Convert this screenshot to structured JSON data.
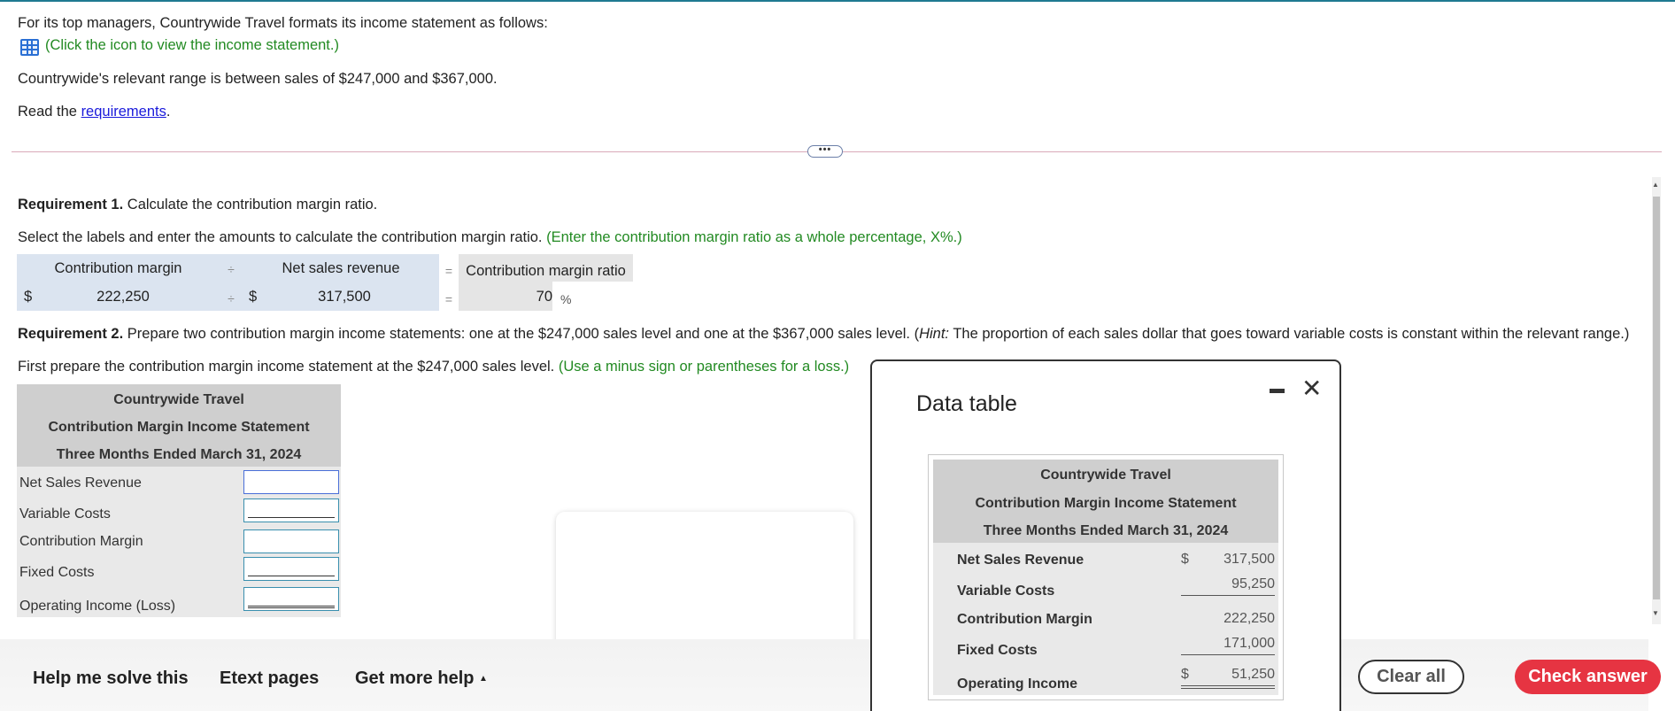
{
  "intro": {
    "line1": "For its top managers, Countrywide Travel formats its income statement as follows:",
    "icon_link": "(Click the icon to view the income statement.)",
    "range_text": "Countrywide's relevant range is between sales of $247,000 and $367,000.",
    "read_prefix": "Read the ",
    "read_link": "requirements",
    "read_suffix": ".",
    "more_button": "•••"
  },
  "req1": {
    "title_bold": "Requirement 1.",
    "title_rest": " Calculate the contribution margin ratio.",
    "instruction": "Select the labels and enter the amounts to calculate the contribution margin ratio.",
    "hint": "(Enter the contribution margin ratio as a whole percentage, X%.)",
    "header_numerator": "Contribution margin",
    "header_divide": "÷",
    "header_denominator": "Net sales revenue",
    "header_equals": "=",
    "header_result": "Contribution margin ratio",
    "dollar": "$",
    "numerator_value": "222,250",
    "divide": "÷",
    "dollar2": "$",
    "denominator_value": "317,500",
    "equals": "=",
    "result_value": "70",
    "percent": "%"
  },
  "req2": {
    "title_bold": "Requirement 2.",
    "title_rest_a": " Prepare two contribution margin income statements: one at the $247,000 sales level and one at the $367,000 sales level. (",
    "hint_italic": "Hint:",
    "title_rest_b": " The proportion of each sales dollar that goes toward variable costs is constant within the relevant range.)",
    "instruction": "First prepare the contribution margin income statement at the $247,000 sales level.",
    "hint": "(Use a minus sign or parentheses for a loss.)"
  },
  "statement": {
    "company": "Countrywide Travel",
    "title": "Contribution Margin Income Statement",
    "period": "Three Months Ended March 31, 2024",
    "rows": [
      "Net Sales Revenue",
      "Variable Costs",
      "Contribution Margin",
      "Fixed Costs",
      "Operating Income (Loss)"
    ]
  },
  "modal": {
    "title": "Data table",
    "company": "Countrywide Travel",
    "statement_title": "Contribution Margin Income Statement",
    "period": "Three Months Ended March 31, 2024",
    "rows": [
      {
        "label": "Net Sales Revenue",
        "dollar": "$",
        "value": "317,500"
      },
      {
        "label": "Variable Costs",
        "dollar": "",
        "value": "95,250"
      },
      {
        "label": "Contribution Margin",
        "dollar": "",
        "value": "222,250"
      },
      {
        "label": "Fixed Costs",
        "dollar": "",
        "value": "171,000"
      },
      {
        "label": "Operating Income",
        "dollar": "$",
        "value": "51,250"
      }
    ],
    "close_glyph": "✕"
  },
  "footer": {
    "help": "Help me solve this",
    "etext": "Etext pages",
    "more_help": "Get more help",
    "more_help_arrow": "▲",
    "clear": "Clear all",
    "check": "Check answer"
  }
}
